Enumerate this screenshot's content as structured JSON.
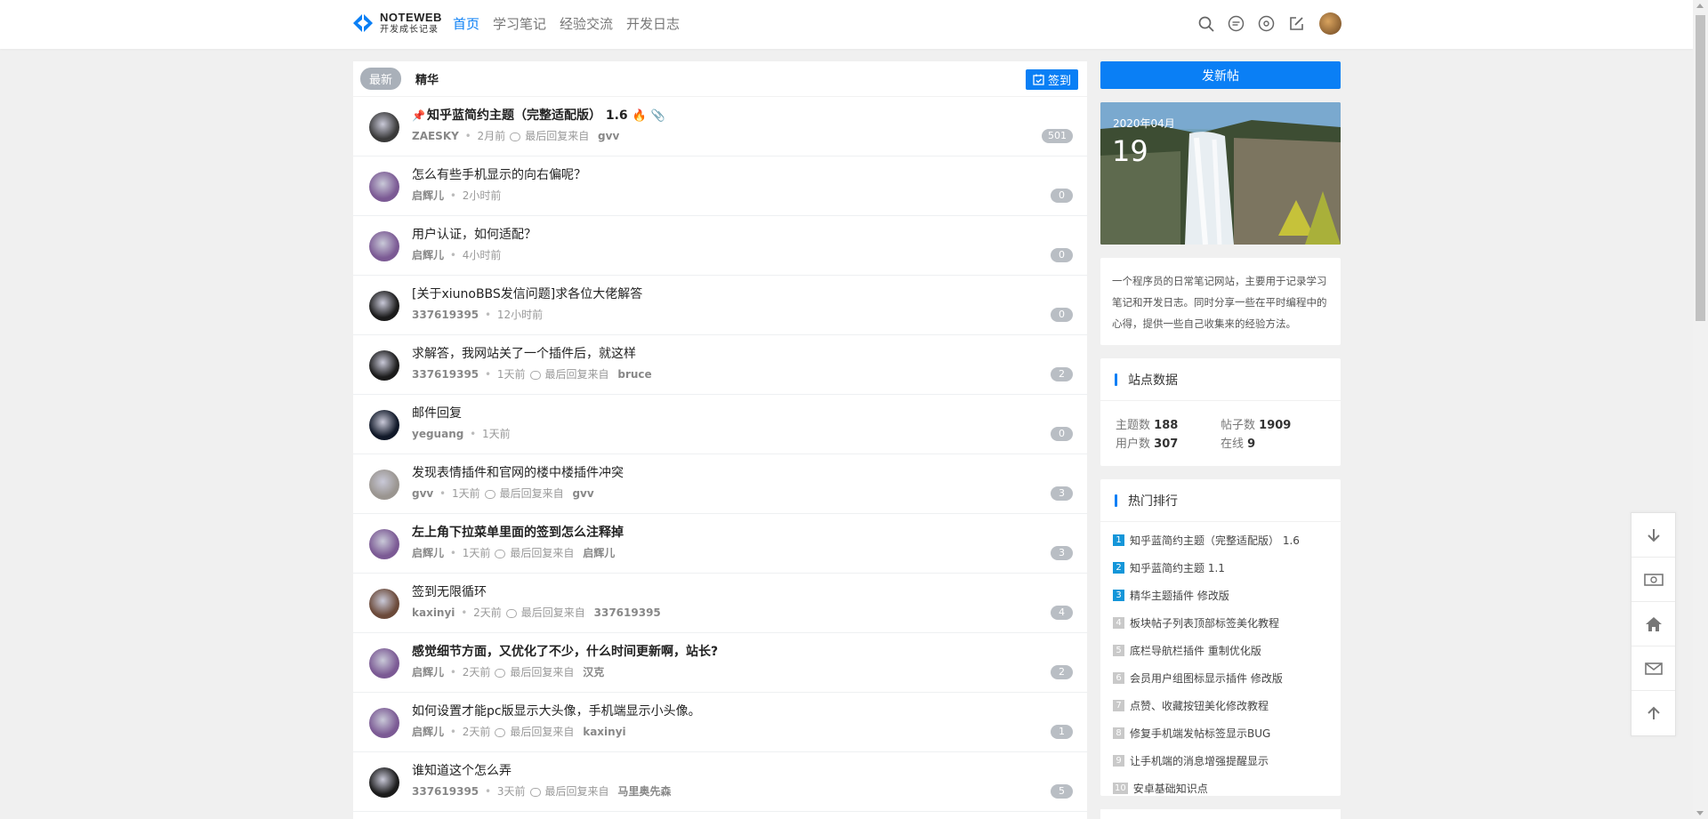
{
  "header": {
    "logo_title": "NOTEWEB",
    "logo_subtitle": "开发成长记录",
    "nav": [
      "首页",
      "学习笔记",
      "经验交流",
      "开发日志"
    ],
    "active_nav": "首页",
    "icons": [
      "search-icon",
      "message-icon",
      "notification-icon",
      "compose-icon",
      "user-avatar"
    ]
  },
  "tabs": {
    "latest": "最新",
    "featured": "精华",
    "signin_label": "签到"
  },
  "threads": [
    {
      "title": "知乎蓝简约主题（完整适配版） 1.6",
      "bold": true,
      "pinned": true,
      "hot": true,
      "attachment": true,
      "user": "ZAESKY",
      "time": "2月前",
      "last_reply_prefix": "最后回复来自",
      "last_reply_user": "gvv",
      "count": "501",
      "avatar_color": "#3a3a3a"
    },
    {
      "title": "怎么有些手机显示的向右偏呢？",
      "bold": false,
      "user": "启辉儿",
      "time": "2小时前",
      "count": "0",
      "avatar_color": "#7b5a94"
    },
    {
      "title": "用户认证，如何适配？",
      "bold": false,
      "user": "启辉儿",
      "time": "4小时前",
      "count": "0",
      "avatar_color": "#7b5a94"
    },
    {
      "title": "[关于xiunoBBS发信问题]求各位大佬解答",
      "bold": false,
      "user": "337619395",
      "time": "12小时前",
      "count": "0",
      "avatar_color": "#1b1b1b"
    },
    {
      "title": "求解答，我网站关了一个插件后，就这样",
      "bold": false,
      "user": "337619395",
      "time": "1天前",
      "last_reply_prefix": "最后回复来自",
      "last_reply_user": "bruce",
      "count": "2",
      "avatar_color": "#1b1b1b"
    },
    {
      "title": "邮件回复",
      "bold": false,
      "user": "yeguang",
      "time": "1天前",
      "count": "0",
      "avatar_color": "#101828"
    },
    {
      "title": "发现表情插件和官网的楼中楼插件冲突",
      "bold": false,
      "user": "gvv",
      "time": "1天前",
      "last_reply_prefix": "最后回复来自",
      "last_reply_user": "gvv",
      "count": "3",
      "avatar_color": "#9a9590"
    },
    {
      "title": "左上角下拉菜单里面的签到怎么注释掉",
      "bold": true,
      "user": "启辉儿",
      "time": "1天前",
      "last_reply_prefix": "最后回复来自",
      "last_reply_user": "启辉儿",
      "count": "3",
      "avatar_color": "#7b5a94"
    },
    {
      "title": "签到无限循环",
      "bold": false,
      "user": "kaxinyi",
      "time": "2天前",
      "last_reply_prefix": "最后回复来自",
      "last_reply_user": "337619395",
      "count": "4",
      "avatar_color": "#6b4a3a"
    },
    {
      "title": "感觉细节方面，又优化了不少，什么时间更新啊，站长?",
      "bold": true,
      "user": "启辉儿",
      "time": "2天前",
      "last_reply_prefix": "最后回复来自",
      "last_reply_user": "汉克",
      "count": "2",
      "avatar_color": "#7b5a94"
    },
    {
      "title": "如何设置才能pc版显示大头像，手机端显示小头像。",
      "bold": false,
      "user": "启辉儿",
      "time": "2天前",
      "last_reply_prefix": "最后回复来自",
      "last_reply_user": "kaxinyi",
      "count": "1",
      "avatar_color": "#7b5a94"
    },
    {
      "title": "谁知道这个怎么弄",
      "bold": false,
      "user": "337619395",
      "time": "3天前",
      "last_reply_prefix": "最后回复来自",
      "last_reply_user": "马里奥先森",
      "count": "5",
      "avatar_color": "#1b1b1b"
    }
  ],
  "sidebar": {
    "new_post": "发新帖",
    "date_month": "2020年04月",
    "date_day": "19",
    "about": "一个程序员的日常笔记网站，主要用于记录学习笔记和开发日志。同时分享一些在平时编程中的心得，提供一些自己收集来的经验方法。",
    "stats_title": "站点数据",
    "stats": {
      "topics_label": "主题数",
      "topics": "188",
      "posts_label": "帖子数",
      "posts": "1909",
      "users_label": "用户数",
      "users": "307",
      "online_label": "在线",
      "online": "9"
    },
    "hot_title": "热门排行",
    "hot": [
      {
        "rank": "1",
        "title": "知乎蓝简约主题（完整适配版） 1.6"
      },
      {
        "rank": "2",
        "title": "知乎蓝简约主题 1.1"
      },
      {
        "rank": "3",
        "title": "精华主题插件 修改版"
      },
      {
        "rank": "4",
        "title": "板块帖子列表顶部标签美化教程"
      },
      {
        "rank": "5",
        "title": "底栏导航栏插件 重制优化版"
      },
      {
        "rank": "6",
        "title": "会员用户组图标显示插件 修改版"
      },
      {
        "rank": "7",
        "title": "点赞、收藏按钮美化修改教程"
      },
      {
        "rank": "8",
        "title": "修复手机端发帖标签显示BUG"
      },
      {
        "rank": "9",
        "title": "让手机端的消息增强提醒显示"
      },
      {
        "rank": "10",
        "title": "安卓基础知识点"
      }
    ]
  },
  "floating_tools": [
    "scroll-down-icon",
    "money-icon",
    "home-icon",
    "mail-icon",
    "scroll-up-icon"
  ],
  "colors": {
    "accent": "#0a7ff5",
    "rank_top": "#1496d9",
    "rank_low": "#c9c9c9",
    "badge": "#b9bec4"
  }
}
